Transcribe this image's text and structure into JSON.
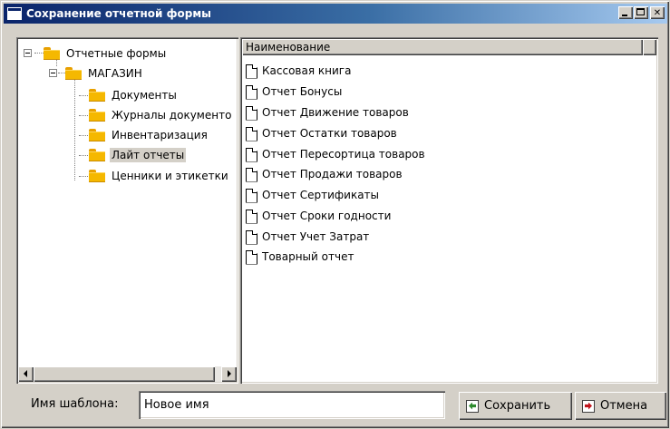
{
  "window": {
    "title": "Сохранение отчетной формы"
  },
  "tree": {
    "root": "Отчетные формы",
    "store": "МАГАЗИН",
    "children": [
      "Документы",
      "Журналы документо",
      "Инвентаризация",
      "Лайт отчеты",
      "Ценники и этикетки"
    ],
    "selected": "Лайт отчеты"
  },
  "list": {
    "column_header": "Наименование",
    "items": [
      "Кассовая книга",
      "Отчет Бонусы",
      "Отчет Движение товаров",
      "Отчет Остатки товаров",
      "Отчет Пересортица товаров",
      "Отчет Продажи товаров",
      "Отчет Сертификаты",
      "Отчет Сроки годности",
      "Отчет Учет Затрат",
      "Товарный отчет"
    ]
  },
  "footer": {
    "name_label": "Имя шаблона:",
    "name_value": "Новое имя",
    "save_label": "Сохранить",
    "cancel_label": "Отмена"
  },
  "icons": {
    "window": "window-icon",
    "folder": "folder-icon",
    "document": "document-icon",
    "save": "save-arrow-icon",
    "cancel": "cancel-arrow-icon"
  },
  "colors": {
    "titlebar_start": "#0a246a",
    "titlebar_end": "#a6caf0",
    "face": "#d4d0c8",
    "folder": "#f5b800"
  }
}
